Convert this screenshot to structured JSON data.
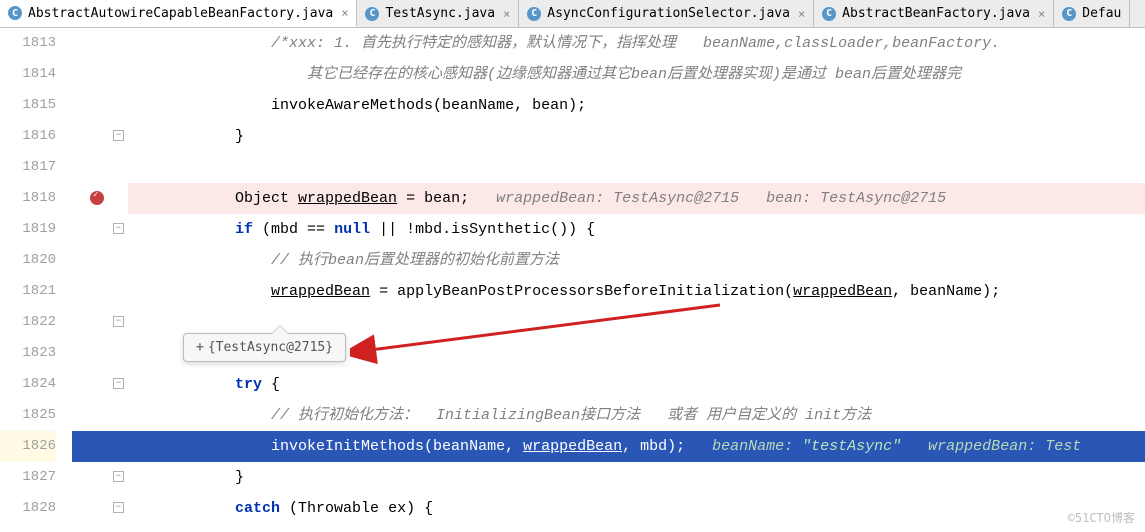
{
  "tabs": [
    {
      "label": "AbstractAutowireCapableBeanFactory.java",
      "active": true
    },
    {
      "label": "TestAsync.java",
      "active": false
    },
    {
      "label": "AsyncConfigurationSelector.java",
      "active": false
    },
    {
      "label": "AbstractBeanFactory.java",
      "active": false
    },
    {
      "label": "Defau",
      "active": false,
      "truncated": true
    }
  ],
  "lines": {
    "start": 1813,
    "end": 1828
  },
  "code": {
    "l1813": "/*xxx: 1. 首先执行特定的感知器，默认情况下，指挥处理   beanName,classLoader,beanFactory.",
    "l1814": "    其它已经存在的核心感知器(边缘感知器通过其它bean后置处理器实现)是通过 bean后置处理器完",
    "l1815_method": "invokeAwareMethods(beanName, bean);",
    "l1816": "}",
    "l1818_decl": "Object ",
    "l1818_var": "wrappedBean",
    "l1818_assign": " = bean;   ",
    "l1818_debug": "wrappedBean: TestAsync@2715   bean: TestAsync@2715",
    "l1819_if": "if",
    "l1819_cond1": " (mbd == ",
    "l1819_null": "null",
    "l1819_cond2": " || !mbd.isSynthetic()) {",
    "l1820_comment": "// 执行bean后置处理器的初始化前置方法",
    "l1821_var": "wrappedBean",
    "l1821_assign": " = applyBeanPostProcessorsBeforeInitialization(",
    "l1821_arg1": "wrappedBean",
    "l1821_rest": ", beanName);",
    "l1822": "}",
    "l1824_try": "try",
    "l1824_brace": " {",
    "l1825_comment": "// 执行初始化方法：  InitializingBean接口方法   或者 用户自定义的 init方法",
    "l1826_method": "invokeInitMethods(beanName, ",
    "l1826_var": "wrappedBean",
    "l1826_rest": ", mbd);   ",
    "l1826_debug_pre": "beanName: ",
    "l1826_debug_str": "\"testAsync\"",
    "l1826_debug_post": "   wrappedBean: Test",
    "l1827": "}",
    "l1828_catch": "catch",
    "l1828_rest": " (Throwable ex) {"
  },
  "tooltip": {
    "plus": "+",
    "text": "{TestAsync@2715}"
  },
  "watermark": "©51CTO博客",
  "breakpoint_line": 1818,
  "exec_line": 1826
}
